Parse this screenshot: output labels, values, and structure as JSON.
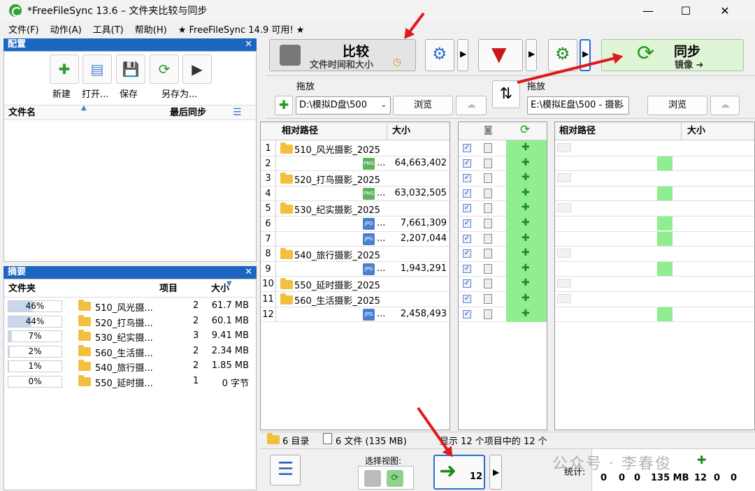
{
  "window": {
    "title": "*FreeFileSync 13.6 – 文件夹比较与同步",
    "minimize": "—",
    "maximize": "☐",
    "close": "✕"
  },
  "menu": [
    "文件(F)",
    "动作(A)",
    "工具(T)",
    "帮助(H)",
    "★ FreeFileSync 14.9 可用! ★"
  ],
  "config_panel": {
    "title": "配置",
    "close": "✕",
    "buttons": {
      "new": "新建",
      "open": "打开...",
      "save": "保存",
      "save_as": "另存为..."
    },
    "col_filename": "文件名",
    "col_last_sync": "最后同步"
  },
  "summary_panel": {
    "title": "摘要",
    "close": "✕",
    "col_folder": "文件夹",
    "col_items": "项目",
    "col_size": "大小",
    "rows": [
      {
        "pct": "46%",
        "pct_value": 46,
        "name": "510_风光摄...",
        "items": "2",
        "size": "61.7 MB"
      },
      {
        "pct": "44%",
        "pct_value": 44,
        "name": "520_打鸟摄...",
        "items": "2",
        "size": "60.1 MB"
      },
      {
        "pct": "7%",
        "pct_value": 7,
        "name": "530_纪实摄...",
        "items": "3",
        "size": "9.41 MB"
      },
      {
        "pct": "2%",
        "pct_value": 2,
        "name": "560_生活摄...",
        "items": "2",
        "size": "2.34 MB"
      },
      {
        "pct": "1%",
        "pct_value": 1,
        "name": "540_旅行摄...",
        "items": "2",
        "size": "1.85 MB"
      },
      {
        "pct": "0%",
        "pct_value": 0,
        "name": "550_延时摄...",
        "items": "1",
        "size": "0 字节"
      }
    ]
  },
  "toolbar": {
    "compare_title": "比较",
    "compare_sub": "文件时间和大小",
    "sync_title": "同步",
    "sync_sub": "镜像 ➜"
  },
  "left_folder": {
    "label": "拖放",
    "path": "D:\\模拟D盘\\500",
    "browse": "浏览"
  },
  "right_folder": {
    "label": "拖放",
    "path": "E:\\模拟E盘\\500 - 摄影",
    "browse": "浏览"
  },
  "grid": {
    "left_col_path": "相对路径",
    "left_col_size": "大小",
    "right_col_path": "相对路径",
    "right_col_size": "大小",
    "rows": [
      {
        "n": "1",
        "folder": "510_风光摄影_2025",
        "type": "",
        "size": ""
      },
      {
        "n": "2",
        "folder": "",
        "type": "PNG",
        "size": "64,663,402"
      },
      {
        "n": "3",
        "folder": "520_打鸟摄影_2025",
        "type": "",
        "size": ""
      },
      {
        "n": "4",
        "folder": "",
        "type": "PNG",
        "size": "63,032,505"
      },
      {
        "n": "5",
        "folder": "530_纪实摄影_2025",
        "type": "",
        "size": ""
      },
      {
        "n": "6",
        "folder": "",
        "type": "JPG",
        "size": "7,661,309"
      },
      {
        "n": "7",
        "folder": "",
        "type": "JPG",
        "size": "2,207,044"
      },
      {
        "n": "8",
        "folder": "540_旅行摄影_2025",
        "type": "",
        "size": ""
      },
      {
        "n": "9",
        "folder": "",
        "type": "JPG",
        "size": "1,943,291"
      },
      {
        "n": "10",
        "folder": "550_延时摄影_2025",
        "type": "",
        "size": ""
      },
      {
        "n": "11",
        "folder": "560_生活摄影_2025",
        "type": "",
        "size": ""
      },
      {
        "n": "12",
        "folder": "",
        "type": "JPG",
        "size": "2,458,493"
      }
    ]
  },
  "status": {
    "dirs": "6 目录",
    "files": "6 文件 (135 MB)",
    "shown": "显示 12 个项目中的 12 个"
  },
  "bottom": {
    "select_view": "选择视图:",
    "create_count": "12",
    "stats_label": "统计:",
    "stats": [
      "0",
      "0",
      "0",
      "135 MB",
      "12",
      "0",
      "0"
    ]
  },
  "watermark": "公众号 · 李春俊"
}
